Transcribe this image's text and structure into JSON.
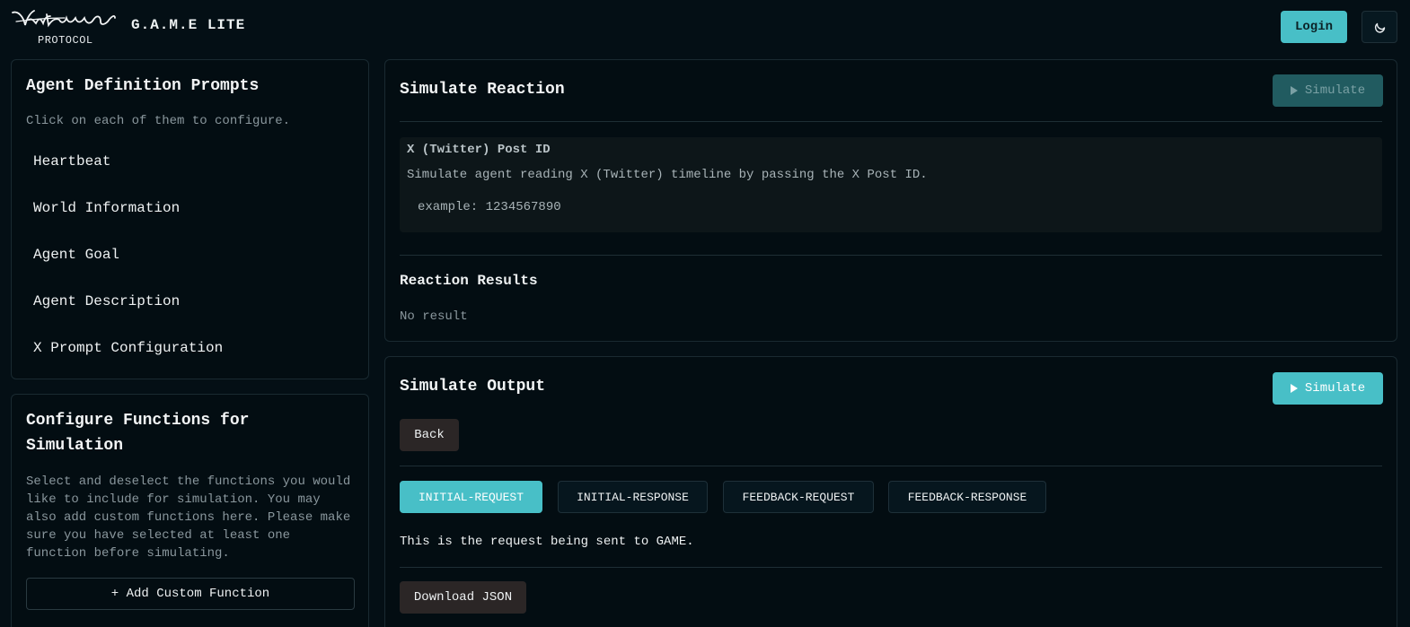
{
  "header": {
    "logo_sub": "PROTOCOL",
    "app_title": "G.A.M.E LITE",
    "login_label": "Login",
    "theme_icon": "moon-icon"
  },
  "agent_panel": {
    "title": "Agent Definition Prompts",
    "subtitle": "Click on each of them to configure.",
    "items": [
      "Heartbeat",
      "World Information",
      "Agent Goal",
      "Agent Description",
      "X Prompt Configuration"
    ]
  },
  "functions_panel": {
    "title_line1": "Configure Functions for",
    "title_line2": "Simulation",
    "description_lines": [
      "Select and deselect the functions you would",
      "like to include for simulation. You may",
      "also add custom functions here. Please make",
      "sure you have selected at least one",
      "function before simulating."
    ],
    "add_label": "+ Add Custom Function"
  },
  "reaction_panel": {
    "title": "Simulate Reaction",
    "simulate_label": "Simulate",
    "field_label": "X (Twitter) Post ID",
    "field_desc": "Simulate agent reading X (Twitter) timeline by passing the X Post ID.",
    "field_example": "example: 1234567890",
    "results_title": "Reaction Results",
    "results_text": "No result"
  },
  "output_panel": {
    "title": "Simulate Output",
    "simulate_label": "Simulate",
    "back_label": "Back",
    "tabs": [
      "INITIAL-REQUEST",
      "INITIAL-RESPONSE",
      "FEEDBACK-REQUEST",
      "FEEDBACK-RESPONSE"
    ],
    "active_tab": "INITIAL-REQUEST",
    "request_text": "This is the request being sent to GAME.",
    "download_label": "Download JSON"
  },
  "colors": {
    "accent": "#48bfc7",
    "background": "#040f15",
    "panel": "#030d12",
    "button_dark": "#2b2626"
  }
}
